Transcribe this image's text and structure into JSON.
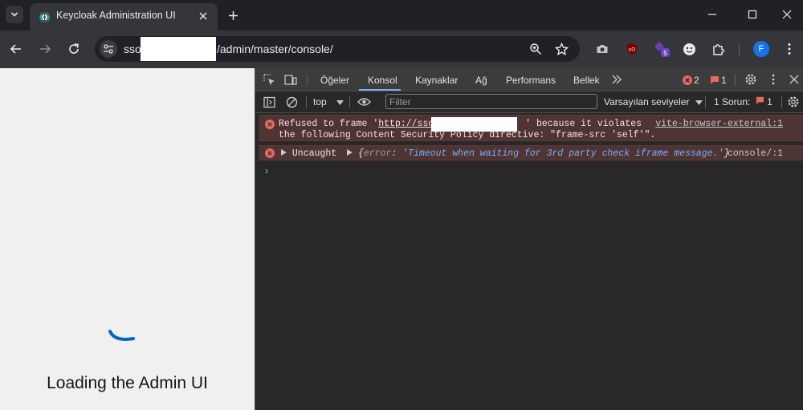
{
  "browser": {
    "tab_title": "Keycloak Administration UI",
    "url_prefix": "sso.",
    "url_path": "/admin/master/console/",
    "profile_initial": "F",
    "ext_badge": "5"
  },
  "page": {
    "loading_text": "Loading the Admin UI"
  },
  "devtools": {
    "tabs": [
      "Öğeler",
      "Konsol",
      "Kaynaklar",
      "Ağ",
      "Performans",
      "Bellek"
    ],
    "error_count": "2",
    "issue_count": "1",
    "context": "top",
    "filter_placeholder": "Filter",
    "levels": "Varsayılan seviyeler",
    "issues_label": "1 Sorun:",
    "issues_badge": "1",
    "messages": [
      {
        "line1_a": "Refused to frame '",
        "link": "http://sso.",
        "line1_b": "' because it violates",
        "line2": "the following Content Security Policy directive: \"frame-src 'self'\".",
        "source": "vite-browser-external:1"
      },
      {
        "prefix": "Uncaught",
        "obj_open": "{",
        "key": "error",
        "value": "'Timeout when waiting for 3rd party check iframe message.'",
        "obj_close": "}",
        "source": "console/:1"
      }
    ]
  }
}
